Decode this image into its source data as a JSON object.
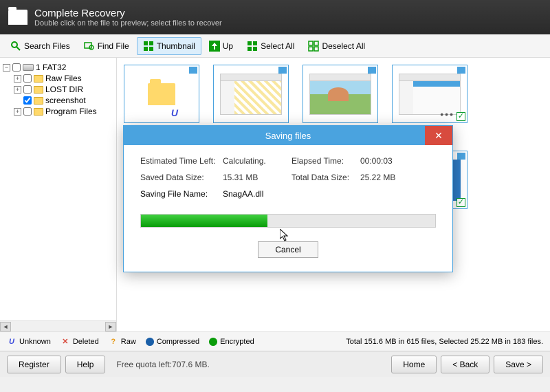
{
  "header": {
    "title": "Complete Recovery",
    "subtitle": "Double click on the file to preview; select files to recover"
  },
  "toolbar": {
    "search": "Search Files",
    "find": "Find File",
    "thumbnail": "Thumbnail",
    "up": "Up",
    "select_all": "Select All",
    "deselect_all": "Deselect All"
  },
  "tree": {
    "root": "1 FAT32",
    "items": [
      "Raw Files",
      "LOST DIR",
      "screenshot",
      "Program Files"
    ]
  },
  "dialog": {
    "title": "Saving files",
    "labels": {
      "eta": "Estimated Time Left:",
      "elapsed": "Elapsed Time:",
      "saved": "Saved Data Size:",
      "total": "Total Data Size:",
      "filename": "Saving File Name:"
    },
    "values": {
      "eta": "Calculating.",
      "elapsed": "00:00:03",
      "saved": "15.31 MB",
      "total": "25.22 MB",
      "filename": "SnagAA.dll"
    },
    "cancel": "Cancel"
  },
  "legend": {
    "unknown": "Unknown",
    "deleted": "Deleted",
    "raw": "Raw",
    "compressed": "Compressed",
    "encrypted": "Encrypted",
    "status": "Total 151.6 MB in 615 files, Selected 25.22 MB in 183 files."
  },
  "footer": {
    "register": "Register",
    "help": "Help",
    "quota": "Free quota left:707.6 MB.",
    "home": "Home",
    "back": "< Back",
    "save": "Save >"
  }
}
